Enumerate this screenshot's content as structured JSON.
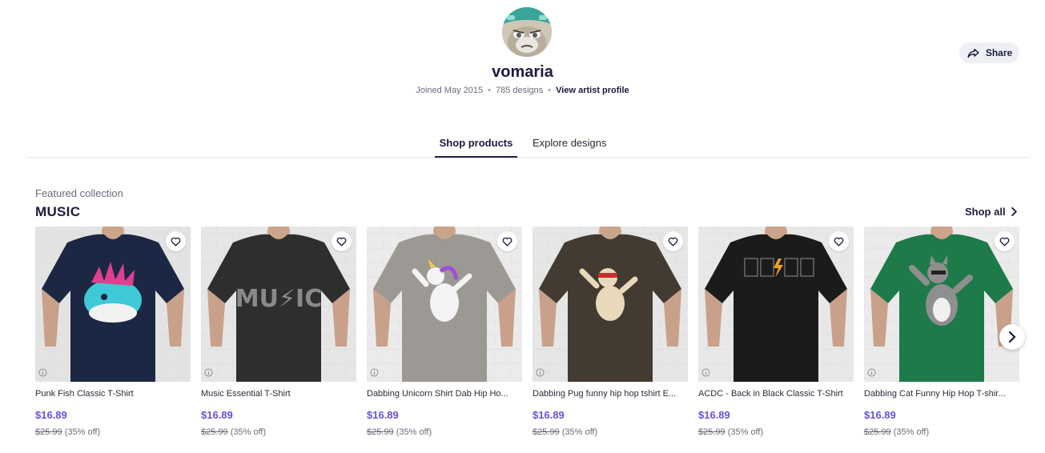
{
  "artist": {
    "username": "vomaria",
    "joined": "Joined May 2015",
    "designs": "785 designs",
    "profile_link": "View artist profile"
  },
  "share": {
    "label": "Share"
  },
  "tabs": [
    {
      "label": "Shop products",
      "active": true
    },
    {
      "label": "Explore designs",
      "active": false
    }
  ],
  "collection": {
    "label": "Featured collection",
    "title": "MUSIC",
    "shop_all": "Shop all"
  },
  "products": [
    {
      "title": "Punk Fish Classic T-Shirt",
      "price": "$16.89",
      "original": "$25.99",
      "discount": "(35% off)",
      "shirt_color": "#1c2743",
      "bg": "#e3e3e3",
      "design": "punk-fish"
    },
    {
      "title": "Music Essential T-Shirt",
      "price": "$16.89",
      "original": "$25.99",
      "discount": "(35% off)",
      "shirt_color": "#2e2e2e",
      "bg": "#e6e6e6",
      "design": "music-text"
    },
    {
      "title": "Dabbing Unicorn Shirt Dab Hip Ho...",
      "price": "$16.89",
      "original": "$25.99",
      "discount": "(35% off)",
      "shirt_color": "#9c9894",
      "bg": "#ebebeb",
      "design": "dabbing-unicorn"
    },
    {
      "title": "Dabbing Pug funny hip hop tshirt E...",
      "price": "$16.89",
      "original": "$25.99",
      "discount": "(35% off)",
      "shirt_color": "#433a31",
      "bg": "#e6e6e6",
      "design": "dabbing-pug"
    },
    {
      "title": "ACDC - Back in Black Classic T-Shirt",
      "price": "$16.89",
      "original": "$25.99",
      "discount": "(35% off)",
      "shirt_color": "#1b1b1b",
      "bg": "#e8e8e8",
      "design": "acdc-chords"
    },
    {
      "title": "Dabbing Cat Funny Hip Hop T-shir...",
      "price": "$16.89",
      "original": "$25.99",
      "discount": "(35% off)",
      "shirt_color": "#1e7a48",
      "bg": "#ebebeb",
      "design": "dabbing-cat"
    }
  ],
  "colors": {
    "accent": "#6254d8",
    "text_dark": "#1d1a3f",
    "muted": "#6b6b7b"
  }
}
